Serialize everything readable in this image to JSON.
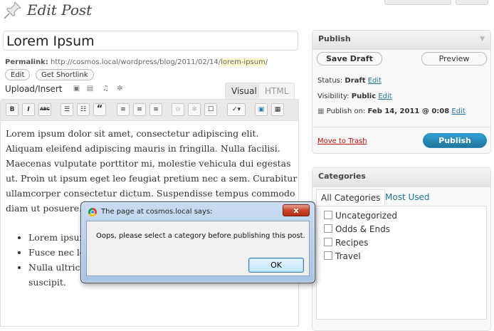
{
  "header": {
    "title": "Edit Post"
  },
  "post": {
    "title": "Lorem Ipsum"
  },
  "permalink": {
    "label": "Permalink:",
    "url_base": "http://cosmos.local/wordpress/blog/2011/02/14/",
    "slug": "lorem-ipsum",
    "url_end": "/",
    "edit_label": "Edit",
    "shortlink_label": "Get Shortlink"
  },
  "upload": {
    "label": "Upload/Insert"
  },
  "editor_tabs": {
    "visual": "Visual",
    "html": "HTML"
  },
  "toolbar": {
    "bold": "B",
    "italic": "I",
    "strike": "ABC",
    "quote": "“"
  },
  "content": {
    "paragraph": "Lorem ipsum dolor sit amet, consectetur adipiscing elit. Aliquam eleifend adipiscing mauris in fringilla. Nulla facilisi. Maecenas vulputate porttitor mi, molestie vehicula dui egestas ut. Proin ut ipsum eget leo feugiat pretium nec a sem. Curabitur ullamcorper consectetur dictum. Suspendisse tempus commodo diam ut posuere.",
    "list": [
      "Lorem ipsum dolor sit amet, consectetur adipiscing elit.",
      "Fusce nec lorem nec dolor.",
      "Nulla ultrices leo sit amet nulla viverra nec pretium est suscipit."
    ]
  },
  "publish": {
    "heading": "Publish",
    "save_draft": "Save Draft",
    "preview": "Preview",
    "status_label": "Status:",
    "status_value": "Draft",
    "visibility_label": "Visibility:",
    "visibility_value": "Public",
    "publish_on_label": "Publish on:",
    "publish_on_value": "Feb 14, 2011 @ 0:08",
    "edit": "Edit",
    "trash": "Move to Trash",
    "publish_button": "Publish"
  },
  "categories": {
    "heading": "Categories",
    "tab_all": "All Categories",
    "tab_most_used": "Most Used",
    "items": [
      "Uncategorized",
      "Odds & Ends",
      "Recipes",
      "Travel"
    ]
  },
  "dialog": {
    "title": "The page at cosmos.local says:",
    "message": "Oops, please select a category before publishing this post.",
    "ok": "OK",
    "close": "x"
  }
}
